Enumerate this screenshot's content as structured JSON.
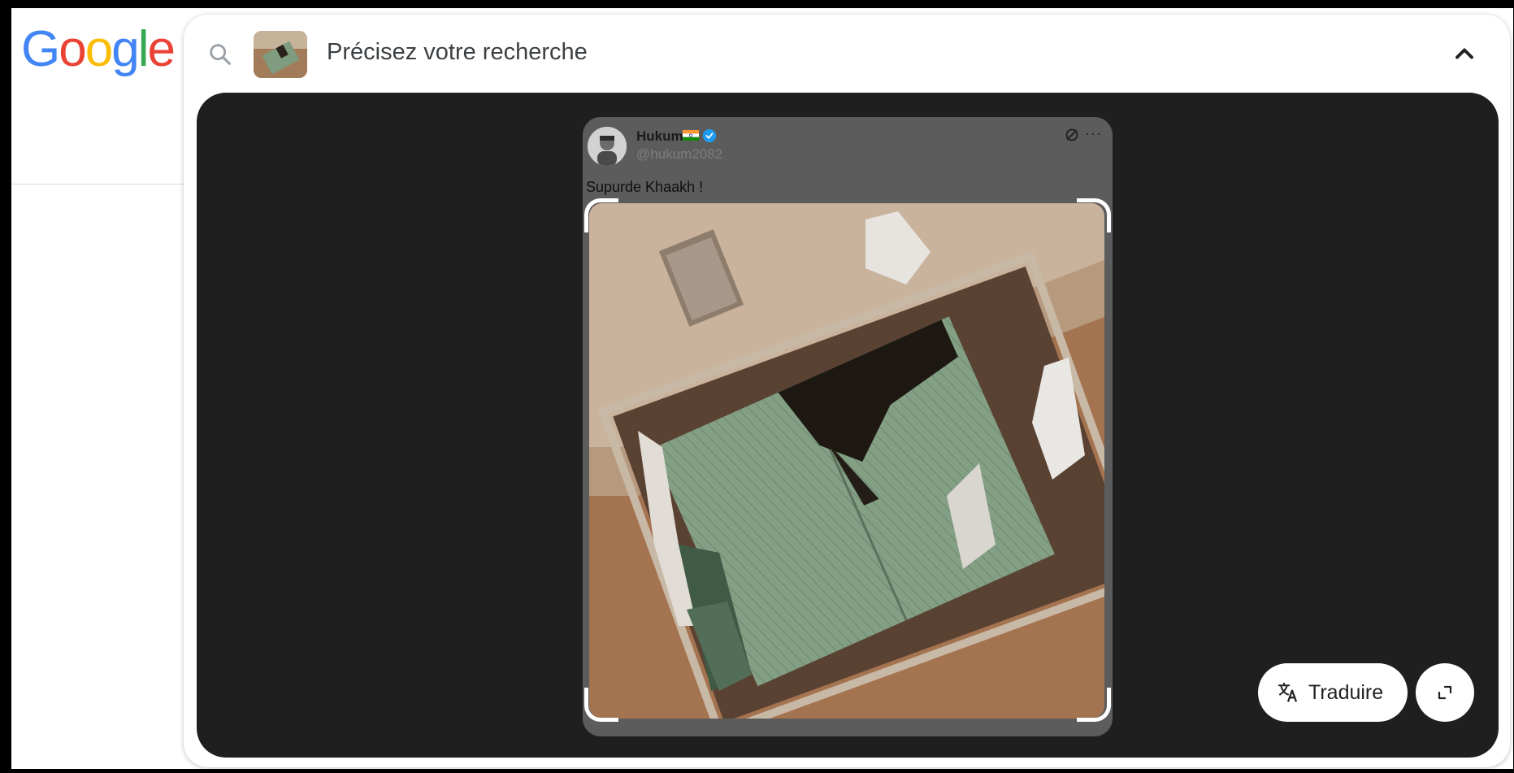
{
  "logo": {
    "letters": [
      "G",
      "o",
      "o",
      "g",
      "l",
      "e"
    ],
    "colors": [
      "#4285F4",
      "#EA4335",
      "#FBBC05",
      "#4285F4",
      "#34A853",
      "#EA4335"
    ]
  },
  "search": {
    "placeholder": "Précisez votre recherche",
    "icon": "search-icon",
    "collapse_icon": "chevron-up-icon"
  },
  "tweet": {
    "display_name": "Hukum",
    "handle": "@hukum2082",
    "text": "Supurde Khaakh !",
    "more": "···"
  },
  "actions": {
    "translate_label": "Traduire",
    "translate_icon": "translate-icon",
    "expand_icon": "expand-icon"
  },
  "colors": {
    "viewer_bg": "#1f1f1f",
    "roof": "#7f9c80",
    "ground": "#a4734f",
    "verified": "#1d9bf0"
  }
}
